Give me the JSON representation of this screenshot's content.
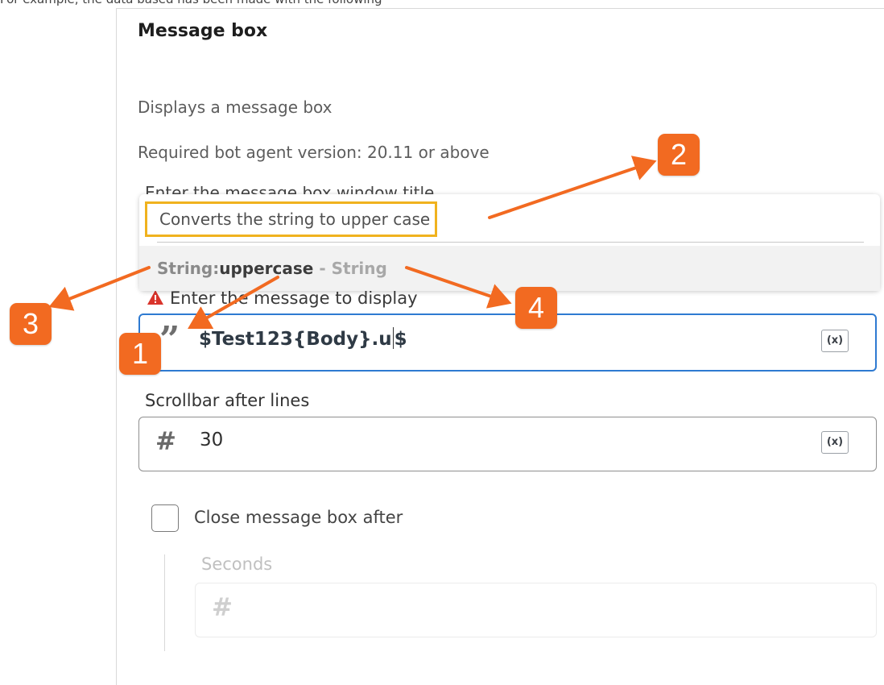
{
  "top_clipped_text": "For example, the data based has been made with the following",
  "panel": {
    "title": "Message box",
    "description": "Displays a message box",
    "required_version": "Required bot agent version: 20.11 or above",
    "hidden_field_label": "Enter the message box window title"
  },
  "autocomplete": {
    "tooltip": "Converts the string to upper case",
    "suggestion_prefix": "String:",
    "suggestion_name": "uppercase",
    "suggestion_type": " - String"
  },
  "message_field": {
    "label": "Enter the message to display",
    "value_before_caret": "$Test123{Body}.u",
    "value_after_caret": "$",
    "var_button": "(x)",
    "quote_icon": "quote-icon",
    "warning_icon": "warning-triangle-icon"
  },
  "scrollbar_field": {
    "label": "Scrollbar after lines",
    "value": "30",
    "var_button": "(x)",
    "icon": "hash-icon"
  },
  "close_after": {
    "label": "Close message box after",
    "checked": false
  },
  "seconds_field": {
    "label": "Seconds",
    "value": "",
    "icon": "hash-icon"
  },
  "callouts": [
    "1",
    "2",
    "3",
    "4"
  ],
  "colors": {
    "accent_blue": "#2e7ad1",
    "highlight_yellow": "#f0b21e",
    "callout_orange": "#f26a21",
    "warning_red": "#d9342b"
  }
}
